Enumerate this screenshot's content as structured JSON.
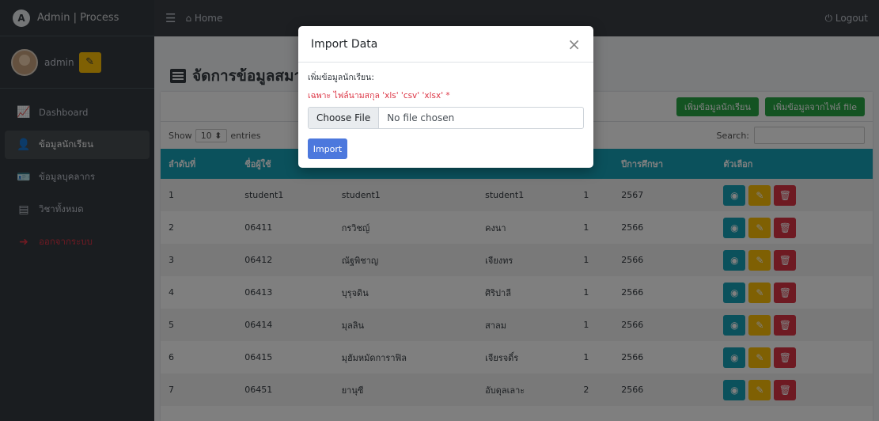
{
  "brand": {
    "title": "Admin | Process"
  },
  "user": {
    "name": "admin"
  },
  "sidebar": {
    "items": [
      {
        "label": "Dashboard",
        "icon": "chart-line-icon"
      },
      {
        "label": "ข้อมูลนักเรียน",
        "icon": "user-card-icon"
      },
      {
        "label": "ข้อมูลบุคลากร",
        "icon": "id-card-icon"
      },
      {
        "label": "วิชาทั้งหมด",
        "icon": "book-icon"
      },
      {
        "label": "ออกจากระบบ",
        "icon": "logout-icon"
      }
    ]
  },
  "topbar": {
    "home": "Home",
    "logout": "Logout"
  },
  "page": {
    "title": "จัดการข้อมูลสมาชิก"
  },
  "card": {
    "btn_add": "เพิ่มข้อมูลนักเรียน",
    "btn_import": "เพิ่มข้อมูลจากไฟล์ file",
    "show_prefix": "Show",
    "show_value": "10",
    "show_suffix": "entries",
    "search_label": "Search:"
  },
  "table": {
    "headers": [
      "ลำดับที่",
      "ชื่อผู้ใช้",
      "",
      "",
      "",
      "ปีการศึกษา",
      "ตัวเลือก"
    ],
    "rows": [
      [
        "1",
        "student1",
        "student1",
        "student1",
        "1",
        "2567"
      ],
      [
        "2",
        "06411",
        "กรวิชญ์",
        "คงนา",
        "1",
        "2566"
      ],
      [
        "3",
        "06412",
        "ณัฐพิชาญ",
        "เจียงทร",
        "1",
        "2566"
      ],
      [
        "4",
        "06413",
        "บุรุจดิน",
        "ศิริปาลี",
        "1",
        "2566"
      ],
      [
        "5",
        "06414",
        "มุลลิน",
        "สาลม",
        "1",
        "2566"
      ],
      [
        "6",
        "06415",
        "มุฮัมหมัดการาฟิล",
        "เจียรจดิ์ร",
        "1",
        "2566"
      ],
      [
        "7",
        "06451",
        "ยานุซี",
        "อับดุลเลาะ",
        "2",
        "2566"
      ]
    ]
  },
  "modal": {
    "title": "Import Data",
    "label": "เพิ่มข้อมูลนักเรียน:",
    "note": "เฉพาะ ไฟล์นามสกุล 'xls' 'csv' 'xlsx' *",
    "choose_file": "Choose File",
    "no_file": "No file chosen",
    "import_btn": "Import"
  }
}
